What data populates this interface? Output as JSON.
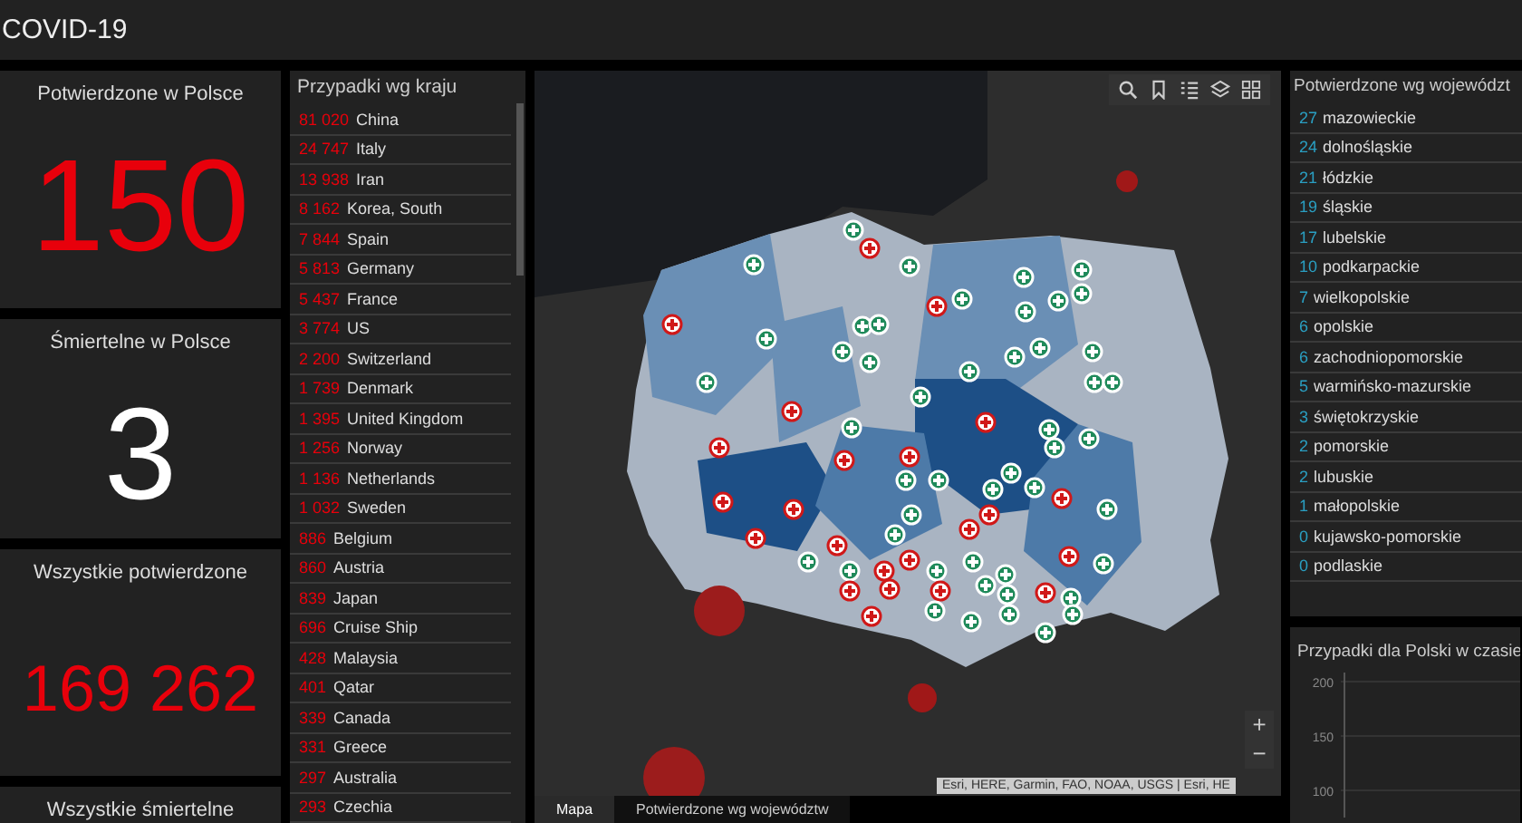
{
  "header": {
    "title": "COVID-19"
  },
  "stats": [
    {
      "label": "Potwierdzone w Polsce",
      "value": "150",
      "kind": "red"
    },
    {
      "label": "Śmiertelne w Polsce",
      "value": "3",
      "kind": "white"
    },
    {
      "label": "Wszystkie potwierdzone",
      "value": "169 262",
      "kind": "red"
    },
    {
      "label": "Wszystkie śmiertelne"
    }
  ],
  "countries": {
    "title": "Przypadki wg kraju",
    "rows": [
      {
        "count": "81 020",
        "name": "China"
      },
      {
        "count": "24 747",
        "name": "Italy"
      },
      {
        "count": "13 938",
        "name": "Iran"
      },
      {
        "count": "8 162",
        "name": "Korea, South"
      },
      {
        "count": "7 844",
        "name": "Spain"
      },
      {
        "count": "5 813",
        "name": "Germany"
      },
      {
        "count": "5 437",
        "name": "France"
      },
      {
        "count": "3 774",
        "name": "US"
      },
      {
        "count": "2 200",
        "name": "Switzerland"
      },
      {
        "count": "1 739",
        "name": "Denmark"
      },
      {
        "count": "1 395",
        "name": "United Kingdom"
      },
      {
        "count": "1 256",
        "name": "Norway"
      },
      {
        "count": "1 136",
        "name": "Netherlands"
      },
      {
        "count": "1 032",
        "name": "Sweden"
      },
      {
        "count": "886",
        "name": "Belgium"
      },
      {
        "count": "860",
        "name": "Austria"
      },
      {
        "count": "839",
        "name": "Japan"
      },
      {
        "count": "696",
        "name": "Cruise Ship"
      },
      {
        "count": "428",
        "name": "Malaysia"
      },
      {
        "count": "401",
        "name": "Qatar"
      },
      {
        "count": "339",
        "name": "Canada"
      },
      {
        "count": "331",
        "name": "Greece"
      },
      {
        "count": "297",
        "name": "Australia"
      },
      {
        "count": "293",
        "name": "Czechia"
      }
    ]
  },
  "map": {
    "attribution": "Esri, HERE, Garmin, FAO, NOAA, USGS | Esri, HE",
    "zoom_in": "+",
    "zoom_out": "−",
    "tabs": [
      {
        "label": "Mapa",
        "selected": true
      },
      {
        "label": "Potwierdzone wg województw",
        "selected": false
      }
    ]
  },
  "provinces": {
    "title": "Potwierdzone wg województ",
    "rows": [
      {
        "count": "27",
        "name": "mazowieckie"
      },
      {
        "count": "24",
        "name": "dolnośląskie"
      },
      {
        "count": "21",
        "name": "łódzkie"
      },
      {
        "count": "19",
        "name": "śląskie"
      },
      {
        "count": "17",
        "name": "lubelskie"
      },
      {
        "count": "10",
        "name": "podkarpackie"
      },
      {
        "count": "7",
        "name": "wielkopolskie"
      },
      {
        "count": "6",
        "name": "opolskie"
      },
      {
        "count": "6",
        "name": "zachodniopomorskie"
      },
      {
        "count": "5",
        "name": "warmińsko-mazurskie"
      },
      {
        "count": "3",
        "name": "świętokrzyskie"
      },
      {
        "count": "2",
        "name": "pomorskie"
      },
      {
        "count": "2",
        "name": "lubuskie"
      },
      {
        "count": "1",
        "name": "małopolskie"
      },
      {
        "count": "0",
        "name": "kujawsko-pomorskie"
      },
      {
        "count": "0",
        "name": "podlaskie"
      }
    ]
  },
  "timeline": {
    "title": "Przypadki dla Polski w czasie",
    "axis_labels": [
      "200",
      "150",
      "100"
    ]
  }
}
